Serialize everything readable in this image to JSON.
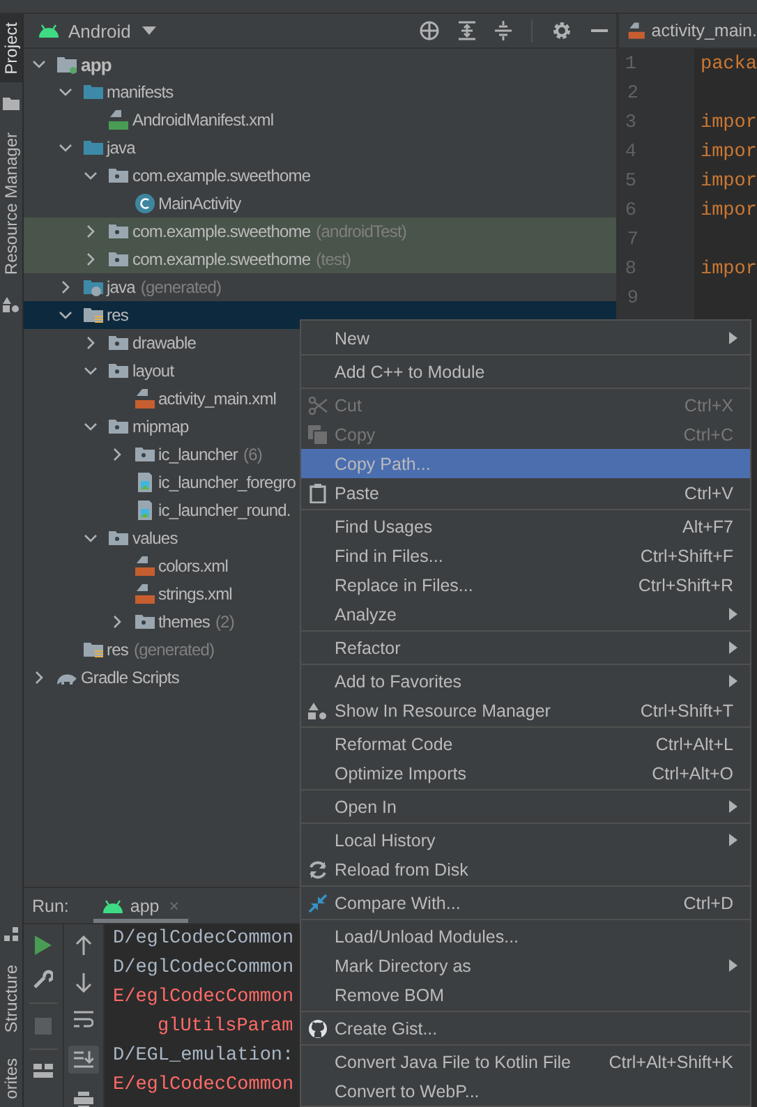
{
  "side_tabs_top": [
    {
      "label": "Project",
      "selected": true
    },
    {
      "label": "Resource Manager",
      "selected": false
    }
  ],
  "side_tabs_bottom": [
    {
      "label": "Structure",
      "selected": false
    },
    {
      "label": "orites",
      "selected": false
    }
  ],
  "project_panel": {
    "view": "Android",
    "tree": [
      {
        "label": "app",
        "kind": "module",
        "expanded": true,
        "selected": false,
        "tinted": false,
        "children": [
          {
            "label": "manifests",
            "kind": "folder",
            "expanded": true,
            "selected": false,
            "tinted": false,
            "children": [
              {
                "label": "AndroidManifest.xml",
                "kind": "manifest",
                "selected": false,
                "tinted": false
              }
            ]
          },
          {
            "label": "java",
            "kind": "folder",
            "expanded": true,
            "selected": false,
            "tinted": false,
            "children": [
              {
                "label": "com.example.sweethome",
                "kind": "package",
                "expanded": true,
                "selected": false,
                "tinted": false,
                "children": [
                  {
                    "label": "MainActivity",
                    "kind": "class",
                    "selected": false,
                    "tinted": false
                  }
                ]
              },
              {
                "label": "com.example.sweethome",
                "note": "(androidTest)",
                "kind": "package",
                "expanded": false,
                "selected": false,
                "tinted": true
              },
              {
                "label": "com.example.sweethome",
                "note": "(test)",
                "kind": "package",
                "expanded": false,
                "selected": false,
                "tinted": true
              }
            ]
          },
          {
            "label": "java",
            "note": "(generated)",
            "kind": "gen-folder",
            "expanded": false,
            "selected": false,
            "tinted": false
          },
          {
            "label": "res",
            "kind": "res-folder",
            "expanded": true,
            "selected": true,
            "tinted": false,
            "children": [
              {
                "label": "drawable",
                "kind": "package",
                "expanded": false,
                "selected": false,
                "tinted": false
              },
              {
                "label": "layout",
                "kind": "package",
                "expanded": true,
                "selected": false,
                "tinted": false,
                "children": [
                  {
                    "label": "activity_main.xml",
                    "kind": "xml",
                    "selected": false,
                    "tinted": false
                  }
                ]
              },
              {
                "label": "mipmap",
                "kind": "package",
                "expanded": true,
                "selected": false,
                "tinted": false,
                "children": [
                  {
                    "label": "ic_launcher",
                    "note": "(6)",
                    "kind": "package",
                    "expanded": false,
                    "selected": false,
                    "tinted": false
                  },
                  {
                    "label": "ic_launcher_foregro",
                    "kind": "image",
                    "selected": false,
                    "tinted": false
                  },
                  {
                    "label": "ic_launcher_round.",
                    "kind": "image",
                    "selected": false,
                    "tinted": false
                  }
                ]
              },
              {
                "label": "values",
                "kind": "package",
                "expanded": true,
                "selected": false,
                "tinted": false,
                "children": [
                  {
                    "label": "colors.xml",
                    "kind": "xml",
                    "selected": false,
                    "tinted": false
                  },
                  {
                    "label": "strings.xml",
                    "kind": "xml",
                    "selected": false,
                    "tinted": false
                  },
                  {
                    "label": "themes",
                    "note": "(2)",
                    "kind": "package",
                    "expanded": false,
                    "selected": false,
                    "tinted": false
                  }
                ]
              }
            ]
          },
          {
            "label": "res",
            "note": "(generated)",
            "kind": "res-folder",
            "selected": false,
            "tinted": false
          }
        ]
      },
      {
        "label": "Gradle Scripts",
        "kind": "gradle",
        "expanded": false,
        "selected": false,
        "tinted": false
      }
    ]
  },
  "editor": {
    "tab": "activity_main.",
    "lines": [
      {
        "number": "1",
        "code": "packa"
      },
      {
        "number": "2"
      },
      {
        "number": "3",
        "code": "impor"
      },
      {
        "number": "4",
        "code": "impor"
      },
      {
        "number": "5",
        "code": "impor"
      },
      {
        "number": "6",
        "code": "impor"
      },
      {
        "number": "7"
      },
      {
        "number": "8",
        "code": "impor"
      },
      {
        "number": "9"
      }
    ]
  },
  "run_panel": {
    "title": "Run:",
    "tab": "app",
    "close": "×",
    "console": [
      {
        "kind": "debug",
        "text": "D/eglCodecCommon"
      },
      {
        "kind": "debug",
        "text": "D/eglCodecCommon"
      },
      {
        "kind": "error",
        "text": "E/eglCodecCommon"
      },
      {
        "kind": "error-cont",
        "text": "glUtilsParam"
      },
      {
        "kind": "debug",
        "text": "D/EGL_emulation:"
      },
      {
        "kind": "error",
        "text": "E/eglCodecCommon"
      }
    ]
  },
  "context_menu": {
    "groups": [
      [
        {
          "label": "New",
          "kind": "plain",
          "submenu": true,
          "disabled": false,
          "selected": false
        }
      ],
      [
        {
          "label": "Add C++ to Module",
          "kind": "plain",
          "submenu": false,
          "disabled": false,
          "selected": false
        }
      ],
      [
        {
          "label": "Cut",
          "kind": "cut",
          "shortcut": "Ctrl+X",
          "submenu": false,
          "disabled": true,
          "selected": false
        },
        {
          "label": "Copy",
          "kind": "copy",
          "shortcut": "Ctrl+C",
          "submenu": false,
          "disabled": true,
          "selected": false
        },
        {
          "label": "Copy Path...",
          "kind": "plain",
          "submenu": false,
          "disabled": false,
          "selected": true
        },
        {
          "label": "Paste",
          "kind": "paste",
          "shortcut": "Ctrl+V",
          "submenu": false,
          "disabled": false,
          "selected": false
        }
      ],
      [
        {
          "label": "Find Usages",
          "kind": "plain",
          "shortcut": "Alt+F7",
          "submenu": false,
          "disabled": false,
          "selected": false
        },
        {
          "label": "Find in Files...",
          "kind": "plain",
          "shortcut": "Ctrl+Shift+F",
          "submenu": false,
          "disabled": false,
          "selected": false
        },
        {
          "label": "Replace in Files...",
          "kind": "plain",
          "shortcut": "Ctrl+Shift+R",
          "submenu": false,
          "disabled": false,
          "selected": false
        },
        {
          "label": "Analyze",
          "kind": "plain",
          "submenu": true,
          "disabled": false,
          "selected": false
        }
      ],
      [
        {
          "label": "Refactor",
          "kind": "plain",
          "submenu": true,
          "disabled": false,
          "selected": false
        }
      ],
      [
        {
          "label": "Add to Favorites",
          "kind": "plain",
          "submenu": true,
          "disabled": false,
          "selected": false
        },
        {
          "label": "Show In Resource Manager",
          "kind": "resources",
          "shortcut": "Ctrl+Shift+T",
          "submenu": false,
          "disabled": false,
          "selected": false
        }
      ],
      [
        {
          "label": "Reformat Code",
          "kind": "plain",
          "shortcut": "Ctrl+Alt+L",
          "submenu": false,
          "disabled": false,
          "selected": false
        },
        {
          "label": "Optimize Imports",
          "kind": "plain",
          "shortcut": "Ctrl+Alt+O",
          "submenu": false,
          "disabled": false,
          "selected": false
        }
      ],
      [
        {
          "label": "Open In",
          "kind": "plain",
          "submenu": true,
          "disabled": false,
          "selected": false
        }
      ],
      [
        {
          "label": "Local History",
          "kind": "plain",
          "submenu": true,
          "disabled": false,
          "selected": false
        },
        {
          "label": "Reload from Disk",
          "kind": "reload",
          "submenu": false,
          "disabled": false,
          "selected": false
        }
      ],
      [
        {
          "label": "Compare With...",
          "kind": "compare",
          "shortcut": "Ctrl+D",
          "submenu": false,
          "disabled": false,
          "selected": false
        }
      ],
      [
        {
          "label": "Load/Unload Modules...",
          "kind": "plain",
          "submenu": false,
          "disabled": false,
          "selected": false
        },
        {
          "label": "Mark Directory as",
          "kind": "plain",
          "submenu": true,
          "disabled": false,
          "selected": false
        },
        {
          "label": "Remove BOM",
          "kind": "plain",
          "submenu": false,
          "disabled": false,
          "selected": false
        }
      ],
      [
        {
          "label": "Create Gist...",
          "kind": "gist",
          "submenu": false,
          "disabled": false,
          "selected": false
        }
      ],
      [
        {
          "label": "Convert Java File to Kotlin File",
          "kind": "plain",
          "shortcut": "Ctrl+Alt+Shift+K",
          "submenu": false,
          "disabled": false,
          "selected": false
        },
        {
          "label": "Convert to WebP...",
          "kind": "plain",
          "submenu": false,
          "disabled": false,
          "selected": false
        }
      ]
    ]
  }
}
